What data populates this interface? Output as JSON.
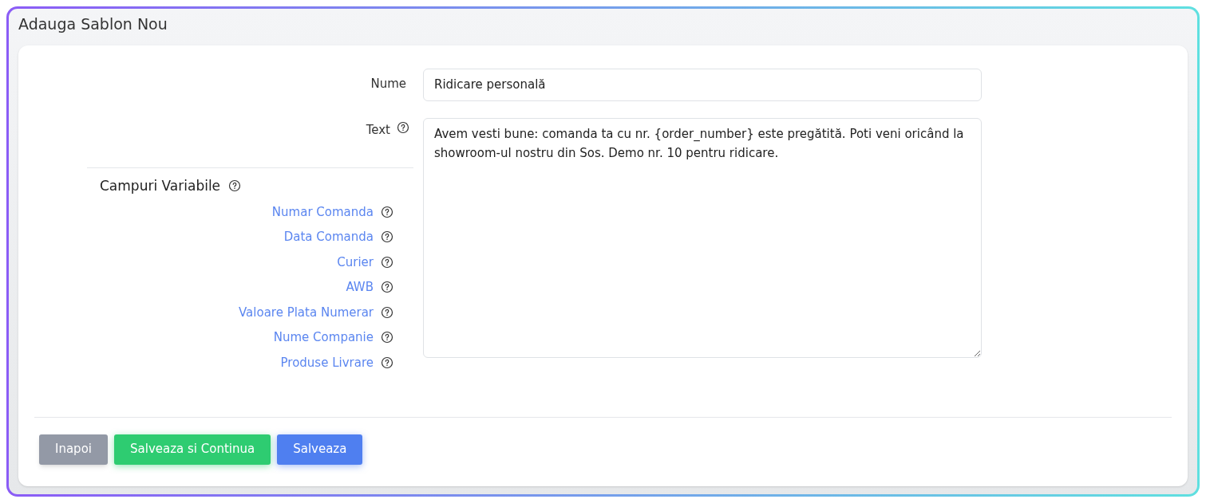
{
  "title": "Adauga Sablon Nou",
  "form": {
    "name_label": "Nume",
    "name_value": "Ridicare personală",
    "text_label": "Text",
    "text_value": "Avem vesti bune: comanda ta cu nr. {order_number} este pregătită. Poti veni oricând la showroom-ul nostru din Sos. Demo nr. 10 pentru ridicare."
  },
  "variables": {
    "title": "Campuri Variabile",
    "items": [
      {
        "label": "Numar Comanda"
      },
      {
        "label": "Data Comanda"
      },
      {
        "label": "Curier"
      },
      {
        "label": "AWB"
      },
      {
        "label": "Valoare Plata Numerar"
      },
      {
        "label": "Nume Companie"
      },
      {
        "label": "Produse Livrare"
      }
    ]
  },
  "buttons": [
    {
      "label": "Inapoi",
      "kind": "secondary"
    },
    {
      "label": "Salveaza si Continua",
      "kind": "success"
    },
    {
      "label": "Salveaza",
      "kind": "primary"
    }
  ]
}
